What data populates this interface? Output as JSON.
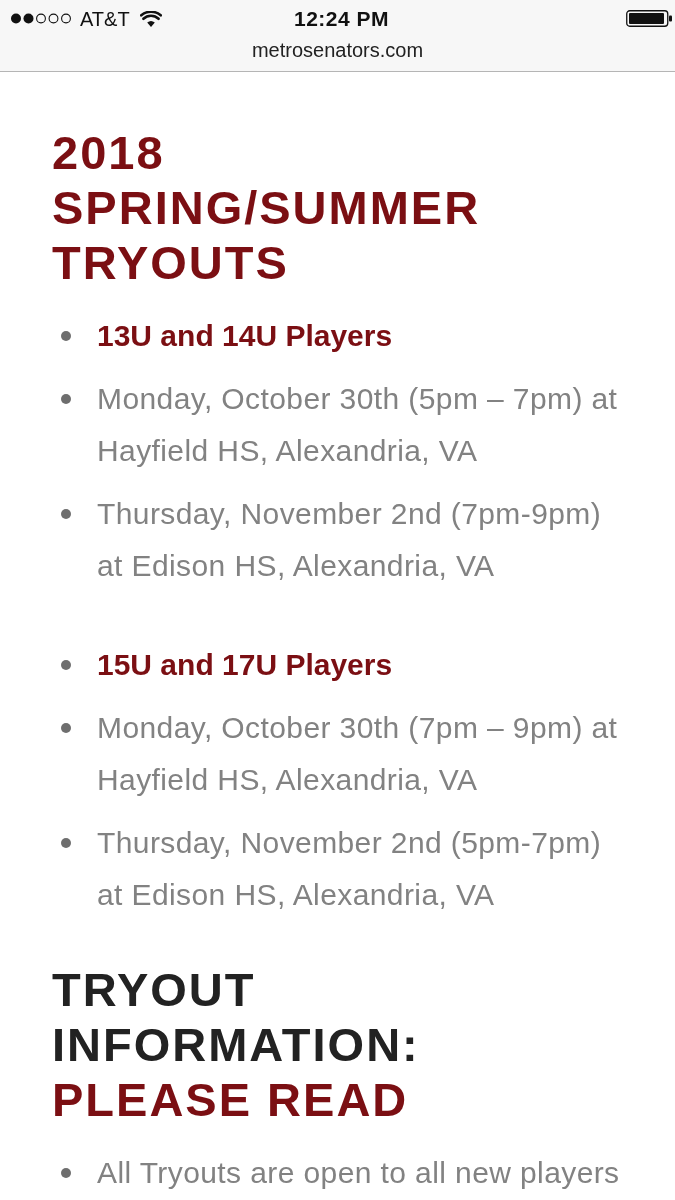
{
  "status_bar": {
    "carrier": "AT&T",
    "time": "12:24 PM",
    "url": "metrosenators.com"
  },
  "sections": [
    {
      "heading": [
        {
          "text": "2018 SPRING/SUMMER TRYOUTS",
          "accent": true
        }
      ],
      "groups": [
        {
          "items": [
            {
              "kind": "subhead",
              "text": "13U and 14U Players"
            },
            {
              "kind": "detail",
              "text": "Monday, October 30th (5pm – 7pm) at Hayfield HS, Alexandria, VA"
            },
            {
              "kind": "detail",
              "text": "Thursday, November 2nd (7pm-9pm) at Edison HS, Alexandria, VA"
            }
          ]
        },
        {
          "items": [
            {
              "kind": "subhead",
              "text": "15U and 17U Players"
            },
            {
              "kind": "detail",
              "text": "Monday, October 30th (7pm – 9pm) at Hayfield HS, Alexandria, VA"
            },
            {
              "kind": "detail",
              "text": "Thursday, November 2nd (5pm-7pm) at Edison HS, Alexandria, VA"
            }
          ]
        }
      ]
    },
    {
      "heading": [
        {
          "text": "TRYOUT INFORMATION:",
          "accent": false
        },
        {
          "text": "PLEASE READ",
          "accent": true
        }
      ],
      "groups": [
        {
          "items": [
            {
              "kind": "detail",
              "text": "All Tryouts are open to all new players"
            }
          ]
        }
      ]
    }
  ]
}
